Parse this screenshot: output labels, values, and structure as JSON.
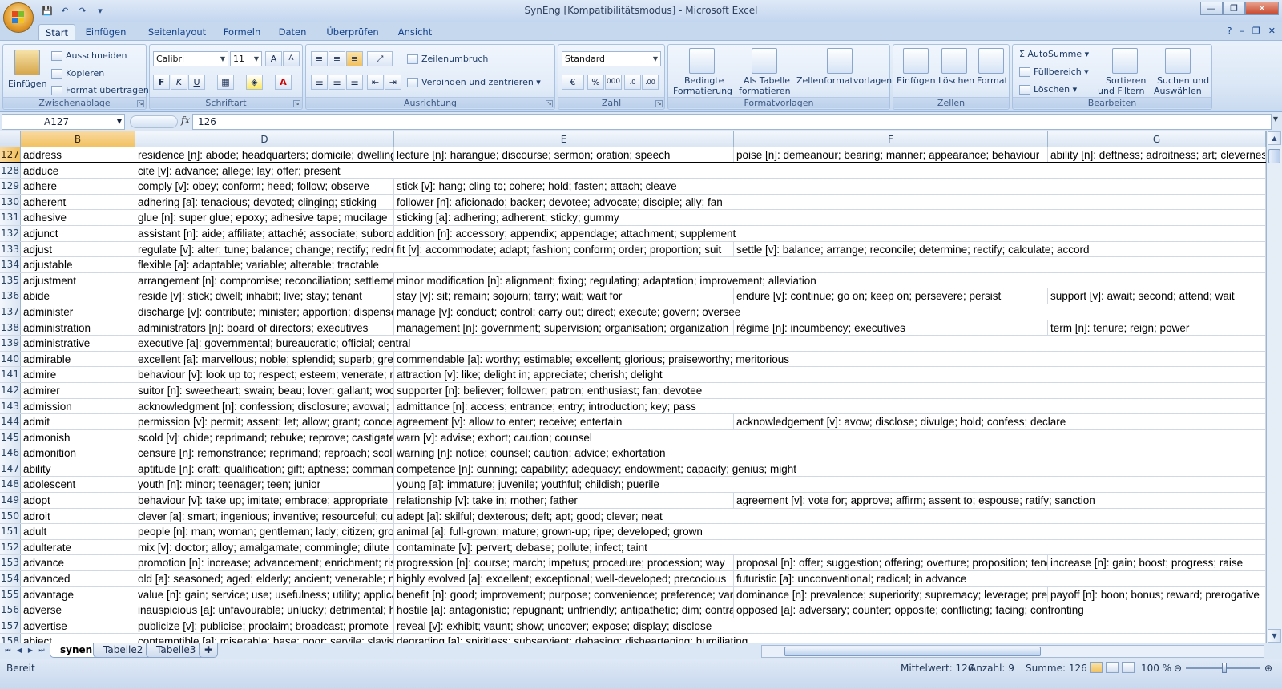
{
  "window": {
    "title": "SynEng  [Kompatibilitätsmodus]  -  Microsoft Excel",
    "controls": {
      "minimize": "—",
      "restore": "❐",
      "close": "✕"
    }
  },
  "qat": {
    "save": "💾",
    "undo": "↶",
    "redo": "↷",
    "more": "▾"
  },
  "tabs": [
    "Start",
    "Einfügen",
    "Seitenlayout",
    "Formeln",
    "Daten",
    "Überprüfen",
    "Ansicht"
  ],
  "active_tab": "Start",
  "ribbon": {
    "clipboard": {
      "label": "Zwischenablage",
      "paste": "Einfügen",
      "cut": "Ausschneiden",
      "copy": "Kopieren",
      "format_painter": "Format übertragen"
    },
    "font": {
      "label": "Schriftart",
      "name": "Calibri",
      "size": "11"
    },
    "alignment": {
      "label": "Ausrichtung",
      "wrap": "Zeilenumbruch",
      "merge": "Verbinden und zentrieren"
    },
    "number": {
      "label": "Zahl",
      "format": "Standard",
      "percent": "%",
      "thousands": "000"
    },
    "styles": {
      "label": "Formatvorlagen",
      "conditional": [
        "Bedingte",
        "Formatierung"
      ],
      "as_table": [
        "Als Tabelle",
        "formatieren"
      ],
      "cell_styles": "Zellenformatvorlagen"
    },
    "cells": {
      "label": "Zellen",
      "insert": "Einfügen",
      "delete": "Löschen",
      "format": "Format"
    },
    "editing": {
      "label": "Bearbeiten",
      "autosum": "AutoSumme",
      "fill": "Füllbereich",
      "clear": "Löschen",
      "sort": [
        "Sortieren",
        "und Filtern"
      ],
      "find": [
        "Suchen und",
        "Auswählen"
      ]
    }
  },
  "formula_bar": {
    "name_box": "A127",
    "fx": "fx",
    "value": "126"
  },
  "columns": [
    "B",
    "D",
    "E",
    "F",
    "G"
  ],
  "rows": [
    {
      "n": "127",
      "b": "address",
      "d": "residence [n]: abode; headquarters; domicile; dwelling",
      "e": "lecture [n]: harangue; discourse; sermon; oration; speech",
      "f": "poise [n]: demeanour; bearing; manner; appearance; behaviour",
      "g": "ability [n]: deftness; adroitness; art; cleverness"
    },
    {
      "n": "128",
      "b": "adduce",
      "d": "cite [v]: advance; allege; lay; offer; present",
      "e": "",
      "f": "",
      "g": ""
    },
    {
      "n": "129",
      "b": "adhere",
      "d": "comply [v]: obey; conform; heed; follow; observe",
      "e": "stick [v]: hang; cling to; cohere; hold; fasten; attach; cleave",
      "f": "",
      "g": ""
    },
    {
      "n": "130",
      "b": "adherent",
      "d": "adhering [a]: tenacious; devoted; clinging; sticking",
      "e": "follower [n]: aficionado; backer; devotee; advocate; disciple; ally; fan",
      "f": "",
      "g": ""
    },
    {
      "n": "131",
      "b": "adhesive",
      "d": "glue [n]: super glue; epoxy; adhesive tape; mucilage",
      "e": "sticking [a]: adhering; adherent; sticky; gummy",
      "f": "",
      "g": ""
    },
    {
      "n": "132",
      "b": "adjunct",
      "d": "assistant [n]: aide; affiliate; attaché; associate; subordinate",
      "e": "addition [n]: accessory; appendix; appendage; attachment; supplement",
      "f": "",
      "g": ""
    },
    {
      "n": "133",
      "b": "adjust",
      "d": "regulate [v]: alter; tune; balance; change; rectify; redress",
      "e": "fit [v]: accommodate; adapt; fashion; conform; order; proportion; suit",
      "f": "settle [v]: balance; arrange; reconcile; determine; rectify; calculate; accord",
      "g": ""
    },
    {
      "n": "134",
      "b": "adjustable",
      "d": "flexible [a]: adaptable; variable; alterable; tractable",
      "e": "",
      "f": "",
      "g": ""
    },
    {
      "n": "135",
      "b": "adjustment",
      "d": "arrangement [n]: compromise; reconciliation; settlement",
      "e": "minor modification [n]: alignment; fixing; regulating; adaptation; improvement; alleviation",
      "f": "",
      "g": ""
    },
    {
      "n": "136",
      "b": "abide",
      "d": "reside [v]: stick; dwell; inhabit; live; stay; tenant",
      "e": "stay [v]: sit; remain; sojourn; tarry; wait; wait for",
      "f": "endure [v]: continue; go on; keep on; persevere; persist",
      "g": "support [v]: await; second; attend; wait"
    },
    {
      "n": "137",
      "b": "administer",
      "d": "discharge [v]: contribute; minister; apportion; dispense",
      "e": "manage [v]: conduct; control; carry out; direct; execute; govern; oversee",
      "f": "",
      "g": ""
    },
    {
      "n": "138",
      "b": "administration",
      "d": "administrators [n]: board of directors; executives",
      "e": "management [n]: government; supervision; organisation; organization",
      "f": "régime [n]: incumbency; executives",
      "g": "term [n]: tenure; reign; power"
    },
    {
      "n": "139",
      "b": "administrative",
      "d": "executive [a]: governmental; bureaucratic; official; central",
      "e": "",
      "f": "",
      "g": ""
    },
    {
      "n": "140",
      "b": "admirable",
      "d": "excellent [a]: marvellous; noble; splendid; superb; great",
      "e": "commendable [a]: worthy; estimable; excellent; glorious; praiseworthy; meritorious",
      "f": "",
      "g": ""
    },
    {
      "n": "141",
      "b": "admire",
      "d": "behaviour [v]: look up to; respect; esteem; venerate; revere",
      "e": "attraction [v]: like; delight in; appreciate; cherish; delight",
      "f": "",
      "g": ""
    },
    {
      "n": "142",
      "b": "admirer",
      "d": "suitor [n]: sweetheart; swain; beau; lover; gallant; wooer",
      "e": "supporter [n]: believer; follower; patron; enthusiast; fan; devotee",
      "f": "",
      "g": ""
    },
    {
      "n": "143",
      "b": "admission",
      "d": "acknowledgment [n]: confession; disclosure; avowal; admittance",
      "e": "admittance [n]: access; entrance; entry; introduction; key; pass",
      "f": "",
      "g": ""
    },
    {
      "n": "144",
      "b": "admit",
      "d": "permission [v]: permit; assent; let; allow; grant; concede",
      "e": "agreement [v]: allow to enter; receive; entertain",
      "f": "acknowledgement [v]: avow; disclose; divulge; hold; confess; declare",
      "g": ""
    },
    {
      "n": "145",
      "b": "admonish",
      "d": "scold [v]: chide; reprimand; rebuke; reprove; castigate",
      "e": "warn [v]: advise; exhort; caution; counsel",
      "f": "",
      "g": ""
    },
    {
      "n": "146",
      "b": "admonition",
      "d": "censure [n]: remonstrance; reprimand; reproach; scolding",
      "e": "warning [n]: notice; counsel; caution; advice; exhortation",
      "f": "",
      "g": ""
    },
    {
      "n": "147",
      "b": "ability",
      "d": "aptitude [n]: craft; qualification; gift; aptness; command",
      "e": "competence [n]: cunning; capability; adequacy; endowment; capacity; genius; might",
      "f": "",
      "g": ""
    },
    {
      "n": "148",
      "b": "adolescent",
      "d": "youth [n]: minor; teenager; teen; junior",
      "e": "young [a]: immature; juvenile; youthful; childish; puerile",
      "f": "",
      "g": ""
    },
    {
      "n": "149",
      "b": "adopt",
      "d": "behaviour [v]: take up; imitate; embrace; appropriate",
      "e": "relationship [v]: take in; mother; father",
      "f": "agreement [v]: vote for; approve; affirm; assent to; espouse; ratify; sanction",
      "g": ""
    },
    {
      "n": "150",
      "b": "adroit",
      "d": "clever [a]: smart; ingenious; inventive; resourceful; cunning",
      "e": "adept [a]: skilful; dexterous; deft; apt; good; clever; neat",
      "f": "",
      "g": ""
    },
    {
      "n": "151",
      "b": "adult",
      "d": "people [n]: man; woman; gentleman; lady; citizen; grown-up",
      "e": "animal [a]: full-grown; mature; grown-up; ripe; developed; grown",
      "f": "",
      "g": ""
    },
    {
      "n": "152",
      "b": "adulterate",
      "d": "mix [v]: doctor; alloy; amalgamate; commingle; dilute",
      "e": "contaminate [v]: pervert; debase; pollute; infect; taint",
      "f": "",
      "g": ""
    },
    {
      "n": "153",
      "b": "advance",
      "d": "promotion [n]: increase; advancement; enrichment; rise",
      "e": "progression [n]: course; march; impetus; procedure; procession; way",
      "f": "proposal [n]: offer; suggestion; offering; overture; proposition; tender",
      "g": "increase [n]: gain; boost; progress; raise"
    },
    {
      "n": "154",
      "b": "advanced",
      "d": "old [a]: seasoned; aged; elderly; ancient; venerable; mature",
      "e": "highly evolved [a]: excellent; exceptional; well-developed; precocious",
      "f": "futuristic [a]: unconventional; radical; in advance",
      "g": ""
    },
    {
      "n": "155",
      "b": "advantage",
      "d": "value [n]: gain; service; use; usefulness; utility; application",
      "e": "benefit [n]: good; improvement; purpose; convenience; preference; vantage",
      "f": "dominance [n]: prevalence; superiority; supremacy; leverage; predominance",
      "g": "payoff [n]: boon; bonus; reward; prerogative"
    },
    {
      "n": "156",
      "b": "adverse",
      "d": "inauspicious [a]: unfavourable; unlucky; detrimental; harmful",
      "e": "hostile [a]: antagonistic; repugnant; unfriendly; antipathetic; dim; contrary",
      "f": "opposed [a]: adversary; counter; opposite; conflicting; facing; confronting",
      "g": ""
    },
    {
      "n": "157",
      "b": "advertise",
      "d": "publicize [v]: publicise; proclaim; broadcast; promote",
      "e": "reveal [v]: exhibit; vaunt; show; uncover; expose; display; disclose",
      "f": "",
      "g": ""
    },
    {
      "n": "158",
      "b": "abject",
      "d": "contemptible [a]: miserable; base; poor; servile; slavish",
      "e": "degrading [a]: spiritless; subservient; debasing; disheartening; humiliating",
      "f": "",
      "g": ""
    }
  ],
  "sheets": [
    "synen",
    "Tabelle2",
    "Tabelle3"
  ],
  "active_sheet": "synen",
  "status": {
    "mode": "Bereit",
    "average": "Mittelwert: 126",
    "count": "Anzahl: 9",
    "sum": "Summe: 126",
    "zoom": "100 %"
  }
}
